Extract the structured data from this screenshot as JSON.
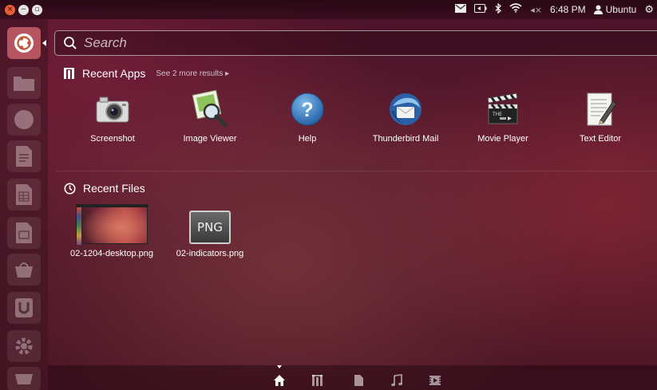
{
  "window_controls": {
    "close_glyph": "×",
    "minimize_glyph": "−",
    "maximize_glyph": "▫"
  },
  "panel": {
    "time": "6:48 PM",
    "user": "Ubuntu",
    "icons": [
      "mail-icon",
      "battery-icon",
      "bluetooth-icon",
      "wifi-icon",
      "volume-muted-icon",
      "user-icon",
      "gear-icon"
    ]
  },
  "launcher": {
    "items": [
      {
        "name": "dash-home-icon",
        "active": true
      },
      {
        "name": "files-icon",
        "active": false
      },
      {
        "name": "firefox-icon",
        "active": false
      },
      {
        "name": "writer-icon",
        "active": false
      },
      {
        "name": "calc-icon",
        "active": false
      },
      {
        "name": "impress-icon",
        "active": false
      },
      {
        "name": "software-center-icon",
        "active": false
      },
      {
        "name": "ubuntu-one-icon",
        "active": false
      },
      {
        "name": "system-settings-icon",
        "active": false
      },
      {
        "name": "trash-icon",
        "active": false
      }
    ]
  },
  "search": {
    "placeholder": "Search",
    "value": ""
  },
  "recent_apps": {
    "title": "Recent Apps",
    "more": "See 2 more results",
    "items": [
      {
        "label": "Screenshot",
        "icon": "camera-icon"
      },
      {
        "label": "Image Viewer",
        "icon": "image-viewer-icon"
      },
      {
        "label": "Help",
        "icon": "help-icon"
      },
      {
        "label": "Thunderbird Mail",
        "icon": "thunderbird-icon"
      },
      {
        "label": "Movie Player",
        "icon": "movie-player-icon"
      },
      {
        "label": "Text Editor",
        "icon": "text-editor-icon"
      }
    ]
  },
  "recent_files": {
    "title": "Recent Files",
    "items": [
      {
        "label": "02-1204-desktop.png",
        "icon": "desktop-thumbnail"
      },
      {
        "label": "02-indicators.png",
        "icon": "png-file-icon",
        "badge": "PNG"
      }
    ]
  },
  "lens_bar": {
    "items": [
      "home-lens-icon",
      "applications-lens-icon",
      "files-lens-icon",
      "music-lens-icon",
      "video-lens-icon"
    ],
    "active": "home-lens-icon"
  },
  "colors": {
    "accent": "#b6545f",
    "close_button": "#e75f32"
  }
}
